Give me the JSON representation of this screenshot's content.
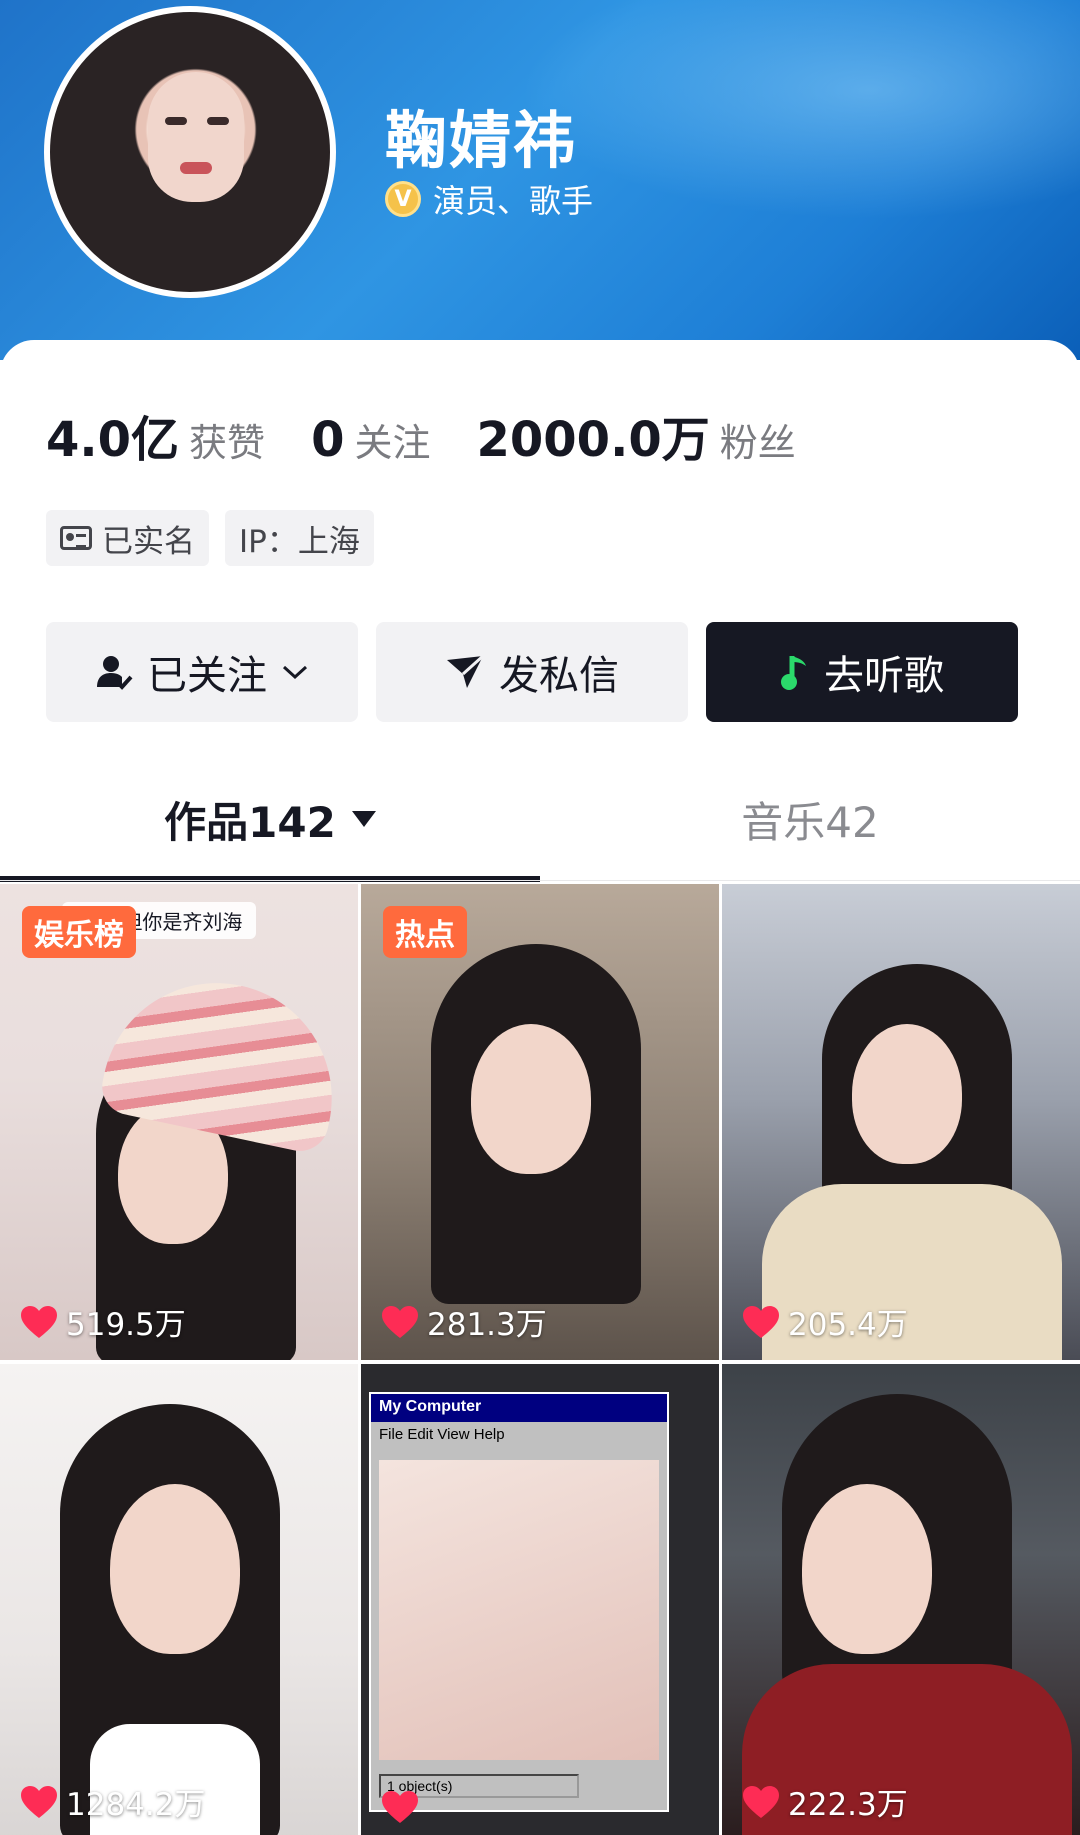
{
  "profile": {
    "name": "鞠婧祎",
    "verify_badge": "V",
    "verify_text": "演员、歌手"
  },
  "stats": [
    {
      "value": "4.0亿",
      "label": "获赞"
    },
    {
      "value": "0",
      "label": "关注"
    },
    {
      "value": "2000.0万",
      "label": "粉丝"
    }
  ],
  "tags": {
    "verified_label": "已实名",
    "ip_label": "IP：上海"
  },
  "actions": {
    "follow": "已关注",
    "message": "发私信",
    "listen": "去听歌"
  },
  "tabs": {
    "works": "作品142",
    "music": "音乐42"
  },
  "grid": [
    {
      "likes": "519.5万",
      "badge": "娱乐榜",
      "caption": "鲨了 但你是齐刘海"
    },
    {
      "likes": "281.3万",
      "badge": "热点"
    },
    {
      "likes": "205.4万"
    },
    {
      "likes": "1284.2万"
    },
    {
      "likes": "",
      "window_title": "My Computer",
      "window_menu": "File  Edit  View  Help",
      "window_status": "1 object(s)"
    },
    {
      "likes": "222.3万"
    }
  ],
  "colors": {
    "header_blue": "#2f95e3",
    "badge_orange": "#ff6a3d",
    "dark_button": "#161823",
    "heart_red": "#fe2c55"
  }
}
